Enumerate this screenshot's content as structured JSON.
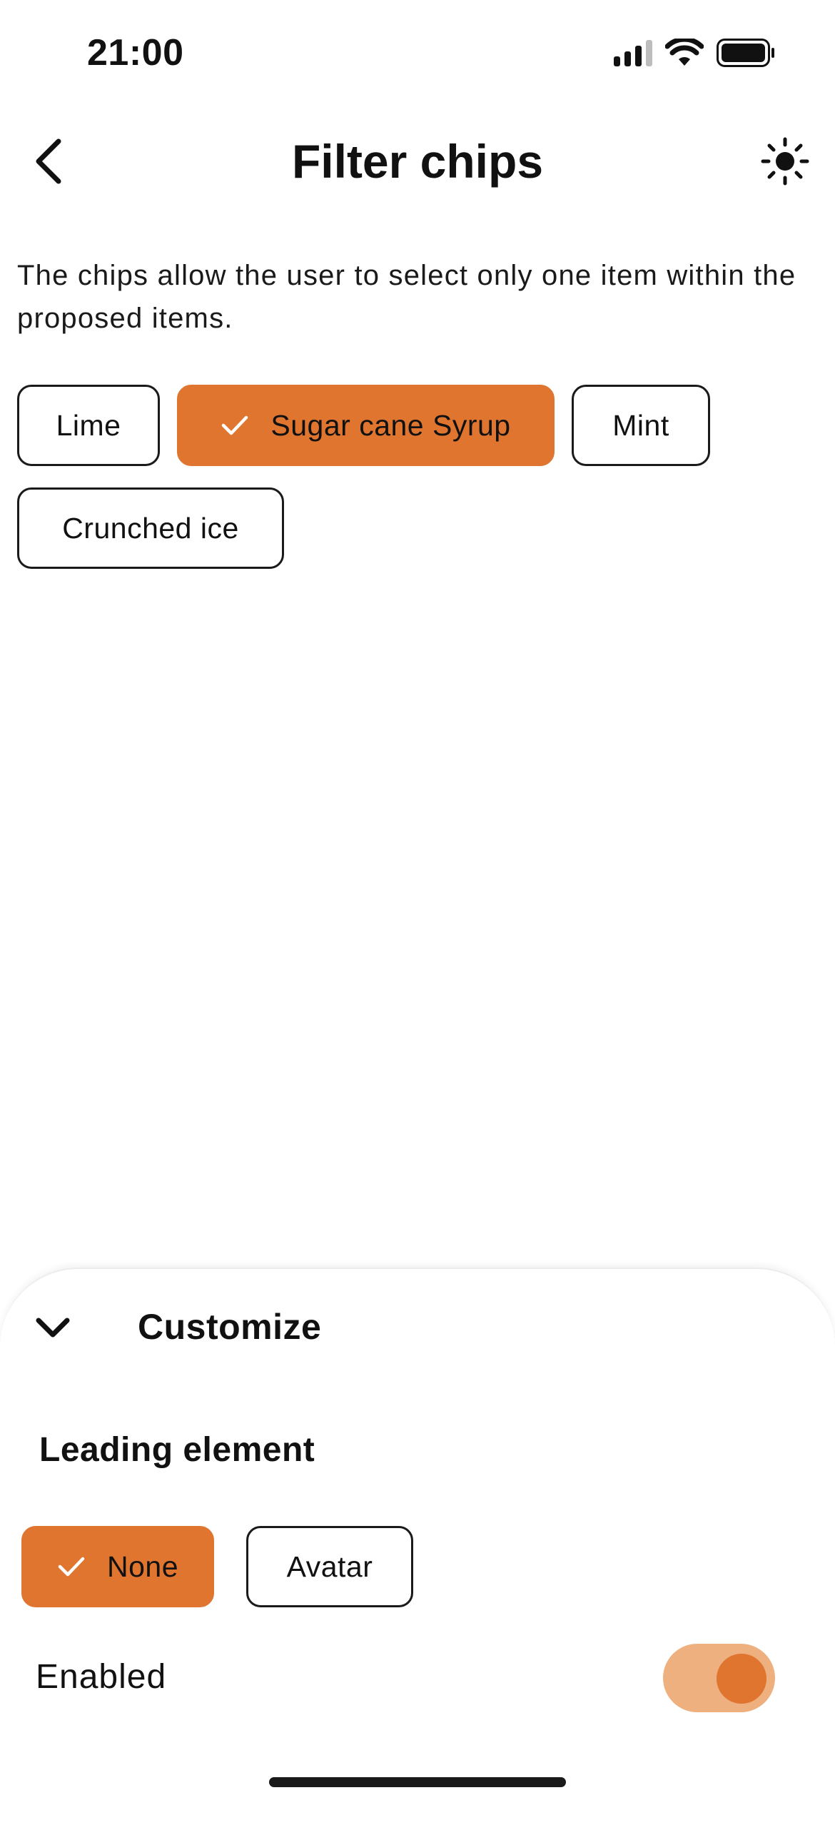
{
  "status_bar": {
    "time": "21:00",
    "signal_icon": "cellular-signal-icon",
    "wifi_icon": "wifi-icon",
    "battery_icon": "battery-icon"
  },
  "header": {
    "back_icon": "chevron-left-icon",
    "title": "Filter chips",
    "theme_icon": "sun-icon"
  },
  "description": "The chips allow the user to select only one item within the proposed items.",
  "chips": [
    {
      "label": "Lime",
      "selected": false
    },
    {
      "label": "Sugar cane Syrup",
      "selected": true
    },
    {
      "label": "Mint",
      "selected": false
    },
    {
      "label": "Crunched ice",
      "selected": false
    }
  ],
  "customize": {
    "chevron_icon": "chevron-down-icon",
    "title": "Customize",
    "leading_element": {
      "title": "Leading element",
      "options": [
        {
          "label": "None",
          "selected": true
        },
        {
          "label": "Avatar",
          "selected": false
        }
      ]
    },
    "enabled": {
      "label": "Enabled",
      "value": true
    }
  },
  "colors": {
    "accent": "#e07530",
    "accent_light": "#eeb07f",
    "text": "#111111",
    "background": "#ffffff"
  }
}
